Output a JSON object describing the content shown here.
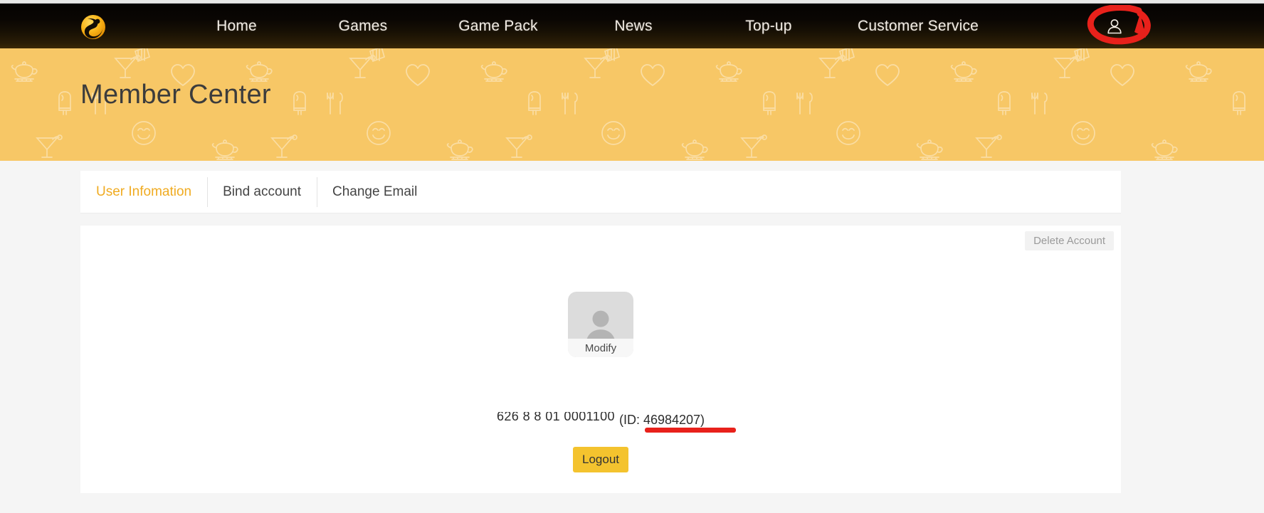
{
  "header": {
    "logo_name": "phoenix-logo",
    "nav_items": [
      {
        "label": "Home"
      },
      {
        "label": "Games"
      },
      {
        "label": "Game Pack"
      },
      {
        "label": "News"
      },
      {
        "label": "Top-up"
      },
      {
        "label": "Customer Service"
      }
    ],
    "account_icon": "user-account-icon",
    "accent_dark": "#0a0603"
  },
  "banner": {
    "title": "Member Center",
    "background_color": "#f7c766",
    "pattern_icons": [
      "teapot-icon",
      "cocktail-glass-icon",
      "heart-icon",
      "popsicle-icon",
      "fork-knife-icon",
      "smiley-face-icon",
      "cake-slice-icon"
    ]
  },
  "tabs": [
    {
      "label": "User Infomation",
      "active": true
    },
    {
      "label": "Bind account",
      "active": false
    },
    {
      "label": "Change Email",
      "active": false
    }
  ],
  "content": {
    "delete_account_label": "Delete Account",
    "avatar_icon": "person-silhouette-icon",
    "modify_label": "Modify",
    "account_name_redacted": "626 8 8 01 0001100",
    "id_text": "(ID: 46984207)",
    "id_value": "46984207",
    "logout_label": "Logout",
    "accent_color": "#f0ab21",
    "logout_color": "#f4c32e"
  },
  "annotations": {
    "circle_target": "user-account-icon",
    "underline_target": "user-id-value",
    "color": "#e8211b"
  }
}
